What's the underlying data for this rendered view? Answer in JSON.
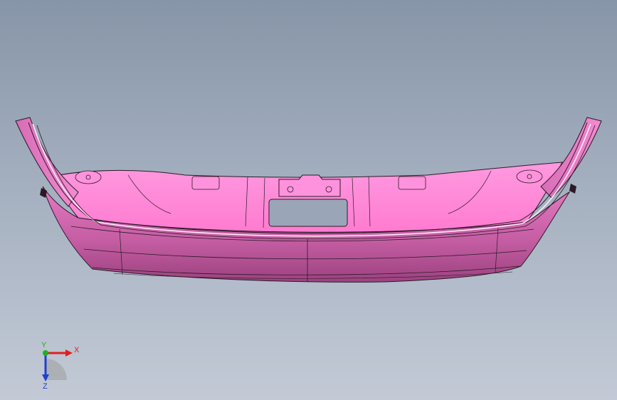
{
  "viewport": {
    "background_top": "#8795a8",
    "background_bottom": "#c3cad6"
  },
  "model": {
    "part_color": "#ff88d6",
    "part_shadow": "#b1508f",
    "edge_color": "#2b1a26"
  },
  "triad": {
    "x_label": "X",
    "y_label": "Y",
    "z_label": "Z",
    "x_color": "#e02020",
    "y_color": "#20b020",
    "z_color": "#2040d0",
    "icons": [
      "x-axis-arrow",
      "y-axis-arrow",
      "z-axis-arrow"
    ]
  }
}
